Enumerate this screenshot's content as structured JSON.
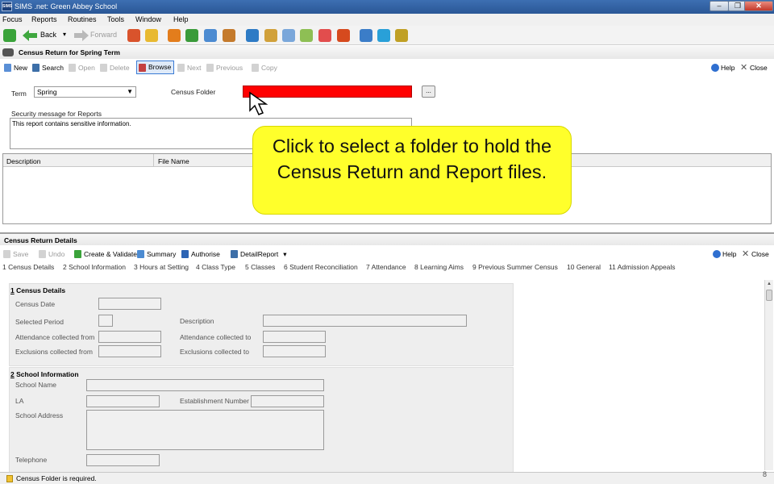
{
  "window": {
    "logo": "SIMS",
    "title": "SIMS .net: Green Abbey School",
    "controls": {
      "minimize": "–",
      "restore": "❐",
      "close": "✕"
    }
  },
  "menu": [
    "Focus",
    "Reports",
    "Routines",
    "Tools",
    "Window",
    "Help"
  ],
  "toolbar": {
    "back": "Back",
    "forward": "Forward"
  },
  "panel1": {
    "title": "Census Return for Spring Term",
    "buttons": {
      "new": "New",
      "search": "Search",
      "open": "Open",
      "delete": "Delete",
      "browse": "Browse",
      "next": "Next",
      "previous": "Previous",
      "copy": "Copy",
      "help": "Help",
      "close": "Close"
    },
    "term_label": "Term",
    "term_value": "Spring",
    "census_folder_label": "Census Folder",
    "browse_ellipsis": "...",
    "security_label": "Security message for Reports",
    "security_text": "This report contains sensitive information.",
    "grid_headers": [
      "Description",
      "File Name"
    ]
  },
  "callout": {
    "text": "Click to select a folder to hold the Census Return and Report files."
  },
  "panel2": {
    "title": "Census Return Details",
    "buttons": {
      "save": "Save",
      "undo": "Undo",
      "create_validate": "Create & Validate",
      "summary": "Summary",
      "authorise": "Authorise",
      "detail_report": "DetailReport",
      "help": "Help",
      "close": "Close"
    },
    "tabs": [
      "1 Census Details",
      "2 School Information",
      "3 Hours at Setting",
      "4 Class Type",
      "5 Classes",
      "6 Student Reconciliation",
      "7 Attendance",
      "8 Learning Aims",
      "9 Previous Summer Census",
      "10 General",
      "11 Admission Appeals"
    ],
    "section1": {
      "number": "1",
      "title": "Census Details",
      "census_date": "Census Date",
      "selected_period": "Selected Period",
      "description": "Description",
      "attendance_from": "Attendance collected from",
      "attendance_to": "Attendance collected to",
      "exclusions_from": "Exclusions collected from",
      "exclusions_to": "Exclusions collected to"
    },
    "section2": {
      "number": "2",
      "title": "School Information",
      "school_name": "School Name",
      "la": "LA",
      "establishment_number": "Establishment Number",
      "school_address": "School Address",
      "telephone": "Telephone"
    }
  },
  "status": {
    "message": "Census Folder is required.",
    "page_number": "8"
  },
  "colors": {
    "census_folder_highlight": "#ff0000",
    "callout_background": "#ffff2b"
  }
}
